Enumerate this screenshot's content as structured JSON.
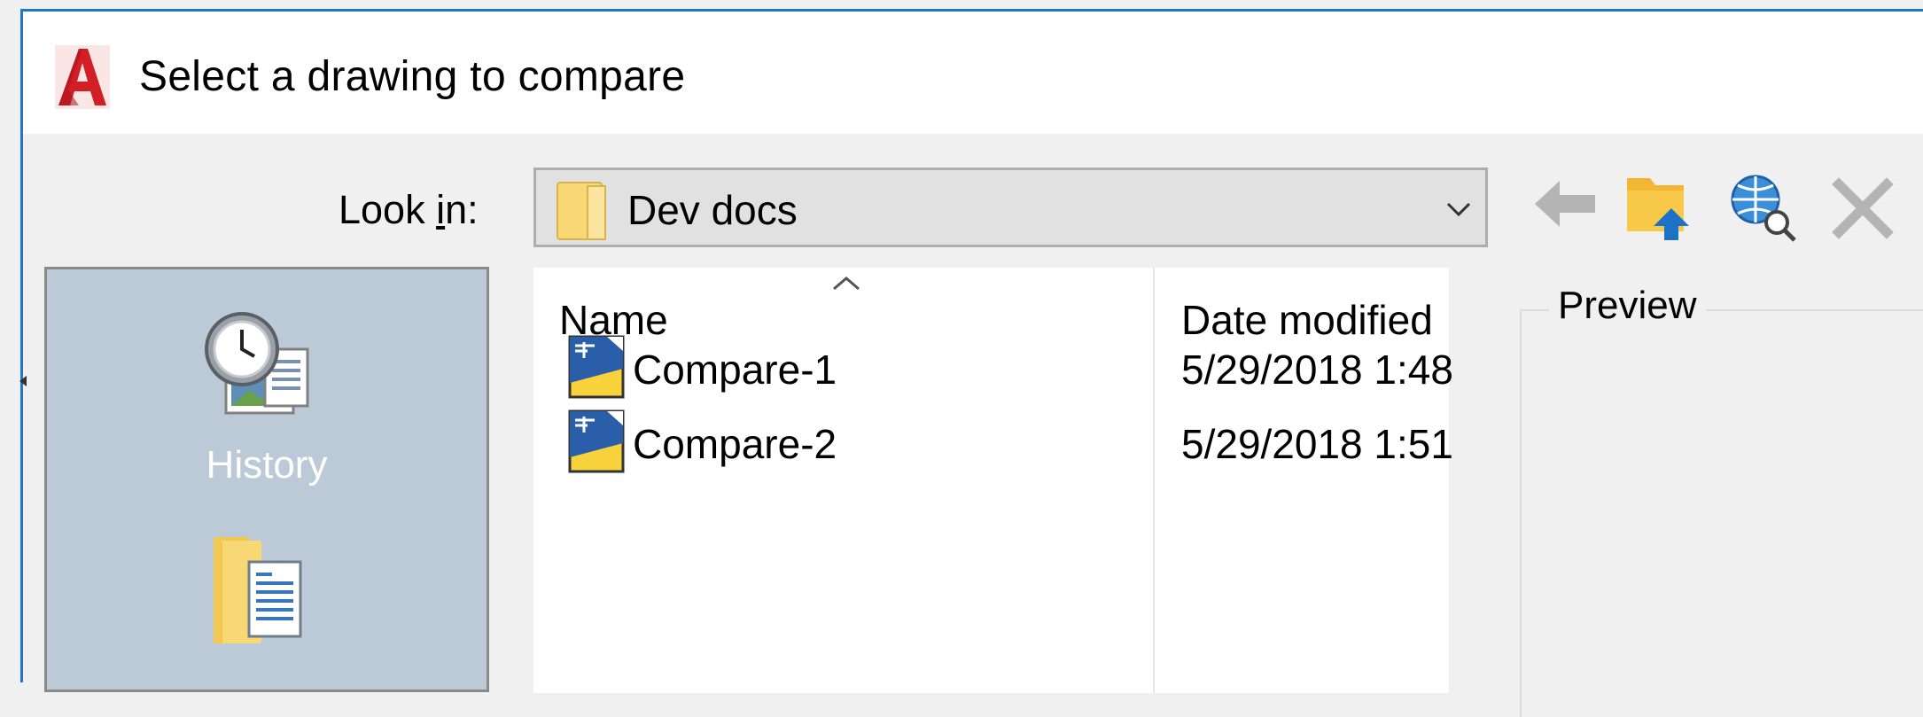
{
  "window": {
    "title": "Select a drawing to compare",
    "app_icon": "autocad-a-icon"
  },
  "look_in": {
    "label_before": "Look ",
    "label_accel": "i",
    "label_after": "n:",
    "value": "Dev docs",
    "folder_icon": "folder-icon"
  },
  "toolbar": {
    "icons": [
      "back-arrow-icon",
      "up-folder-icon",
      "search-web-icon",
      "delete-icon",
      "new-folder-icon"
    ]
  },
  "places": {
    "items": [
      {
        "label": "History",
        "icon": "history-clock-icon"
      },
      {
        "label": "",
        "icon": "documents-folder-icon"
      }
    ]
  },
  "file_list": {
    "columns": [
      "Name",
      "Date modified"
    ],
    "rows": [
      {
        "name": "Compare-1",
        "date": "5/29/2018 1:48",
        "icon": "dwg-file-icon"
      },
      {
        "name": "Compare-2",
        "date": "5/29/2018 1:51",
        "icon": "dwg-file-icon"
      }
    ]
  },
  "preview": {
    "label": "Preview"
  },
  "colors": {
    "accent_border": "#1e78c8",
    "places_bg": "#bccad8",
    "folder_yellow": "#f8d775"
  }
}
